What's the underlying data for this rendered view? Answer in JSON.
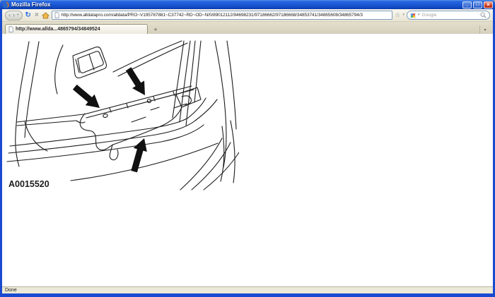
{
  "window": {
    "title": "Mozilla Firefox",
    "controls": {
      "minimize": "_",
      "maximize": "□",
      "close": "×"
    }
  },
  "toolbar": {
    "back_glyph": "‹",
    "forward_glyph": "›",
    "nav_caret": "▾",
    "reload_glyph": "↻",
    "stop_glyph": "×",
    "url": "http://www.alldatapro.com/alldata/PRO~V195787881~C37742~RD~OD~N/0/89012112/94698231/97186662/97186668/34853741/34865608/34865794/3",
    "bookmark_star_glyph": "☆",
    "bookmark_caret": "▾",
    "search_placeholder": "Google",
    "search_caret": "▾"
  },
  "tabbar": {
    "active_tab_title": "http://www.allda...4865794/34849524",
    "new_tab_glyph": "+",
    "list_all_tabs_glyph": "▾"
  },
  "content": {
    "figure_label": "A0015520"
  },
  "statusbar": {
    "text": "Done"
  },
  "colors": {
    "titlebar_blue": "#1c5ad8",
    "window_border_blue": "#1a4ad0",
    "toolbar_beige": "#ece9d8",
    "url_field_border": "#7f9db9",
    "close_button_red": "#d44830",
    "diagram_line": "#1c1c1c",
    "arrow_fill": "#111111"
  }
}
